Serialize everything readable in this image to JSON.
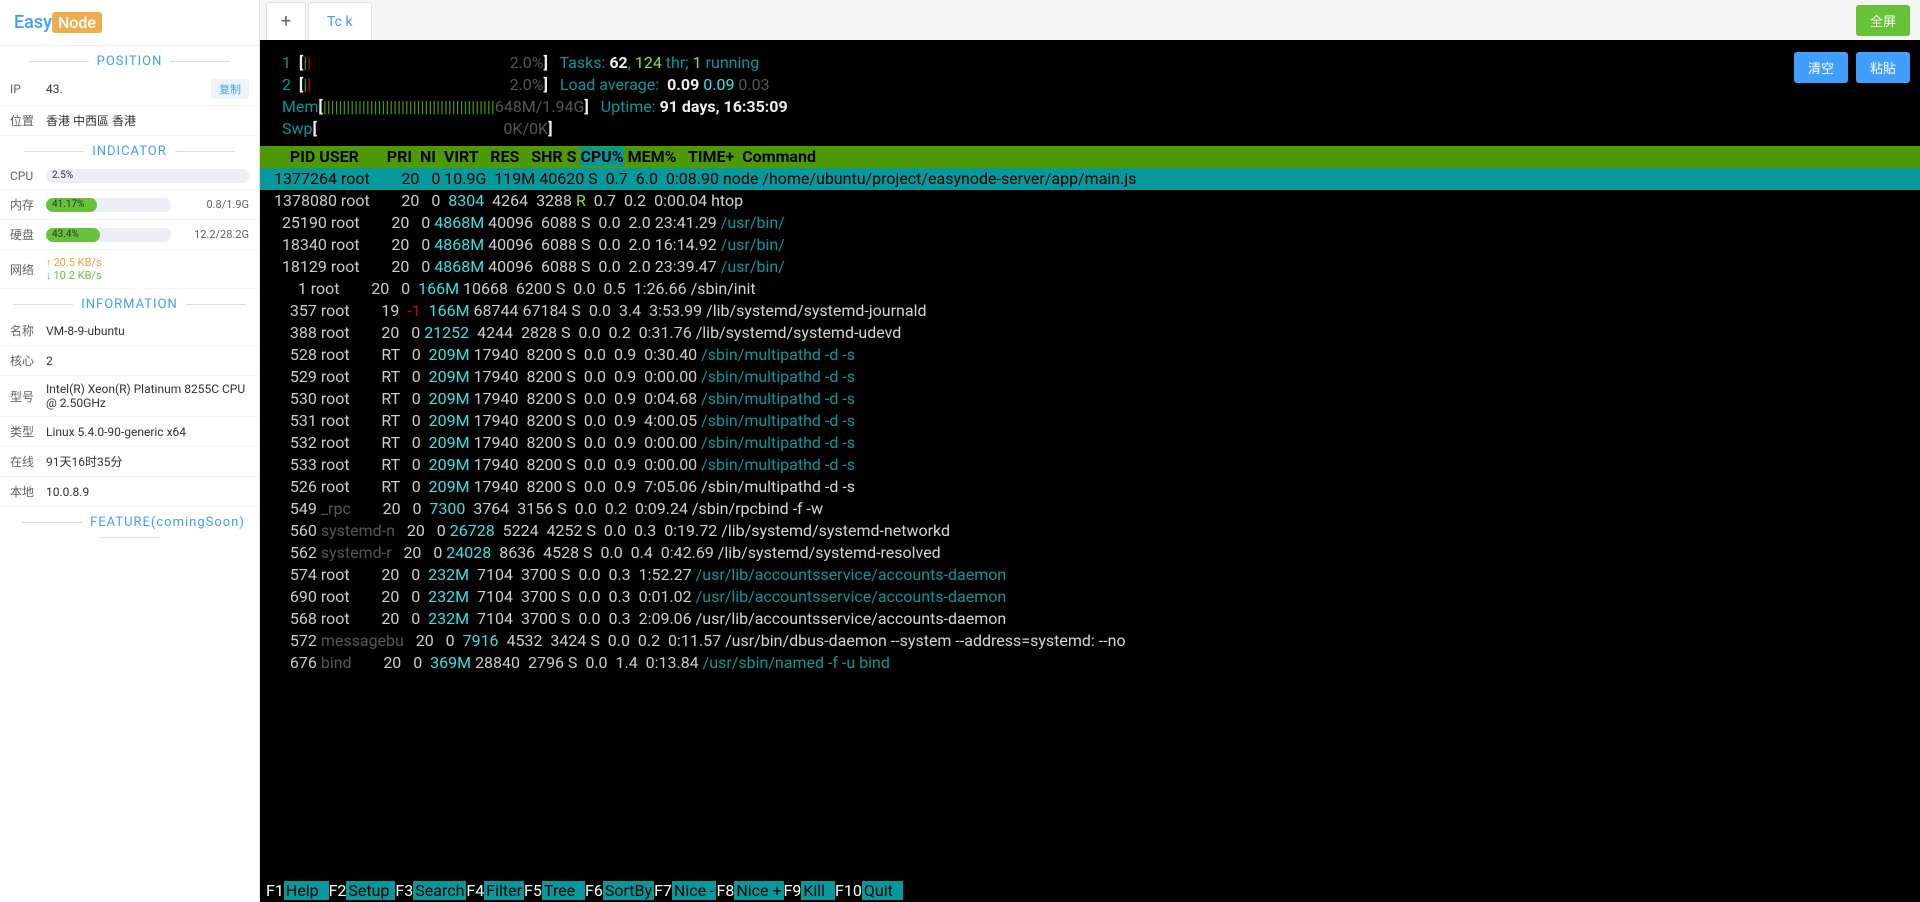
{
  "logo": {
    "part1": "Easy",
    "part2": "Node"
  },
  "tabs": {
    "add": "+",
    "active": "Tc       k"
  },
  "buttons": {
    "fullscreen": "全屏",
    "clear": "清空",
    "paste": "粘貼",
    "copy": "复制"
  },
  "sections": {
    "position": "POSITION",
    "indicator": "INDICATOR",
    "information": "INFORMATION",
    "feature": "FEATURE(comingSoon)"
  },
  "position": {
    "ip_label": "IP",
    "ip_value": "43.",
    "loc_label": "位置",
    "loc_value": "香港 中西區 香港"
  },
  "indicator": {
    "cpu_label": "CPU",
    "cpu_pct": "2.5%",
    "cpu_width": "2.5%",
    "mem_label": "内存",
    "mem_pct": "41.17%",
    "mem_width": "41.17%",
    "mem_right": "0.8/1.9G",
    "disk_label": "硬盘",
    "disk_pct": "43.4%",
    "disk_width": "43.4%",
    "disk_right": "12.2/28.2G",
    "net_label": "网络",
    "net_up": "20.5 KB/s",
    "net_down": "10.2 KB/s"
  },
  "info": {
    "name_label": "名称",
    "name_value": "VM-8-9-ubuntu",
    "cores_label": "核心",
    "cores_value": "2",
    "model_label": "型号",
    "model_value": "Intel(R) Xeon(R) Platinum 8255C CPU @ 2.50GHz",
    "type_label": "类型",
    "type_value": "Linux 5.4.0-90-generic x64",
    "online_label": "在线",
    "online_value": "91天16时35分",
    "local_label": "本地",
    "local_value": "10.0.8.9"
  },
  "htop": {
    "cpu1_pct": "2.0%",
    "cpu2_pct": "2.0%",
    "mem_used": "648M",
    "mem_total": "1.94G",
    "swp": "0K/0K",
    "tasks_label": "Tasks: ",
    "tasks": "62",
    "threads": "124",
    "thr_txt": " thr; ",
    "running": "1",
    "running_txt": " running",
    "load_label": "Load average:  ",
    "load1": "0.09",
    "load2": "0.09",
    "load3": "0.03",
    "uptime_label": "Uptime: ",
    "uptime": "91 days, 16:35:09",
    "header": "    PID USER       PRI  NI  VIRT   RES   SHR S CPU% MEM%   TIME+  Command",
    "rows": [
      {
        "sel": true,
        "pid": "1377264",
        "user": "root",
        "pri": "20",
        "ni": "0",
        "virt": "10.9G",
        "res": "119M",
        "shr": "40620",
        "s": "S",
        "cpu": "0.7",
        "mem": "6.0",
        "time": "0:08.90",
        "cmd": "node /home/ubuntu/project/easynode-server/app/main.js",
        "dimcmd": false
      },
      {
        "pid": "1378080",
        "user": "root",
        "pri": "20",
        "ni": "0",
        "virt": "8304",
        "res": "4264",
        "shr": "3288",
        "s": "R",
        "cpu": "0.7",
        "mem": "0.2",
        "time": "0:00.04",
        "cmd": "htop"
      },
      {
        "pid": "25190",
        "user": "root",
        "pri": "20",
        "ni": "0",
        "virt": "4868M",
        "res": "40096",
        "shr": "6088",
        "s": "S",
        "cpu": "0.0",
        "mem": "2.0",
        "time": "23:41.29",
        "cmd": "/usr/bin/",
        "dimcmd": true
      },
      {
        "pid": "18340",
        "user": "root",
        "pri": "20",
        "ni": "0",
        "virt": "4868M",
        "res": "40096",
        "shr": "6088",
        "s": "S",
        "cpu": "0.0",
        "mem": "2.0",
        "time": "16:14.92",
        "cmd": "/usr/bin/",
        "dimcmd": true
      },
      {
        "pid": "18129",
        "user": "root",
        "pri": "20",
        "ni": "0",
        "virt": "4868M",
        "res": "40096",
        "shr": "6088",
        "s": "S",
        "cpu": "0.0",
        "mem": "2.0",
        "time": "23:39.47",
        "cmd": "/usr/bin/",
        "dimcmd": true
      },
      {
        "pid": "1",
        "user": "root",
        "pri": "20",
        "ni": "0",
        "virt": "166M",
        "res": "10668",
        "shr": "6200",
        "s": "S",
        "cpu": "0.0",
        "mem": "0.5",
        "time": "1:26.66",
        "cmd": "/sbin/init"
      },
      {
        "pid": "357",
        "user": "root",
        "pri": "19",
        "ni": "-1",
        "virt": "166M",
        "res": "68744",
        "shr": "67184",
        "s": "S",
        "cpu": "0.0",
        "mem": "3.4",
        "time": "3:53.99",
        "cmd": "/lib/systemd/systemd-journald"
      },
      {
        "pid": "388",
        "user": "root",
        "pri": "20",
        "ni": "0",
        "virt": "21252",
        "res": "4244",
        "shr": "2828",
        "s": "S",
        "cpu": "0.0",
        "mem": "0.2",
        "time": "0:31.76",
        "cmd": "/lib/systemd/systemd-udevd"
      },
      {
        "pid": "528",
        "user": "root",
        "pri": "RT",
        "ni": "0",
        "virt": "209M",
        "res": "17940",
        "shr": "8200",
        "s": "S",
        "cpu": "0.0",
        "mem": "0.9",
        "time": "0:30.40",
        "cmd": "/sbin/multipathd -d -s",
        "dimcmd": true
      },
      {
        "pid": "529",
        "user": "root",
        "pri": "RT",
        "ni": "0",
        "virt": "209M",
        "res": "17940",
        "shr": "8200",
        "s": "S",
        "cpu": "0.0",
        "mem": "0.9",
        "time": "0:00.00",
        "cmd": "/sbin/multipathd -d -s",
        "dimcmd": true
      },
      {
        "pid": "530",
        "user": "root",
        "pri": "RT",
        "ni": "0",
        "virt": "209M",
        "res": "17940",
        "shr": "8200",
        "s": "S",
        "cpu": "0.0",
        "mem": "0.9",
        "time": "0:04.68",
        "cmd": "/sbin/multipathd -d -s",
        "dimcmd": true
      },
      {
        "pid": "531",
        "user": "root",
        "pri": "RT",
        "ni": "0",
        "virt": "209M",
        "res": "17940",
        "shr": "8200",
        "s": "S",
        "cpu": "0.0",
        "mem": "0.9",
        "time": "4:00.05",
        "cmd": "/sbin/multipathd -d -s",
        "dimcmd": true
      },
      {
        "pid": "532",
        "user": "root",
        "pri": "RT",
        "ni": "0",
        "virt": "209M",
        "res": "17940",
        "shr": "8200",
        "s": "S",
        "cpu": "0.0",
        "mem": "0.9",
        "time": "0:00.00",
        "cmd": "/sbin/multipathd -d -s",
        "dimcmd": true
      },
      {
        "pid": "533",
        "user": "root",
        "pri": "RT",
        "ni": "0",
        "virt": "209M",
        "res": "17940",
        "shr": "8200",
        "s": "S",
        "cpu": "0.0",
        "mem": "0.9",
        "time": "0:00.00",
        "cmd": "/sbin/multipathd -d -s",
        "dimcmd": true
      },
      {
        "pid": "526",
        "user": "root",
        "pri": "RT",
        "ni": "0",
        "virt": "209M",
        "res": "17940",
        "shr": "8200",
        "s": "S",
        "cpu": "0.0",
        "mem": "0.9",
        "time": "7:05.06",
        "cmd": "/sbin/multipathd -d -s"
      },
      {
        "pid": "549",
        "user": "_rpc",
        "pri": "20",
        "ni": "0",
        "virt": "7300",
        "res": "3764",
        "shr": "3156",
        "s": "S",
        "cpu": "0.0",
        "mem": "0.2",
        "time": "0:09.24",
        "cmd": "/sbin/rpcbind -f -w"
      },
      {
        "pid": "560",
        "user": "systemd-n",
        "pri": "20",
        "ni": "0",
        "virt": "26728",
        "res": "5224",
        "shr": "4252",
        "s": "S",
        "cpu": "0.0",
        "mem": "0.3",
        "time": "0:19.72",
        "cmd": "/lib/systemd/systemd-networkd"
      },
      {
        "pid": "562",
        "user": "systemd-r",
        "pri": "20",
        "ni": "0",
        "virt": "24028",
        "res": "8636",
        "shr": "4528",
        "s": "S",
        "cpu": "0.0",
        "mem": "0.4",
        "time": "0:42.69",
        "cmd": "/lib/systemd/systemd-resolved"
      },
      {
        "pid": "574",
        "user": "root",
        "pri": "20",
        "ni": "0",
        "virt": "232M",
        "res": "7104",
        "shr": "3700",
        "s": "S",
        "cpu": "0.0",
        "mem": "0.3",
        "time": "1:52.27",
        "cmd": "/usr/lib/accountsservice/accounts-daemon",
        "dimcmd": true
      },
      {
        "pid": "690",
        "user": "root",
        "pri": "20",
        "ni": "0",
        "virt": "232M",
        "res": "7104",
        "shr": "3700",
        "s": "S",
        "cpu": "0.0",
        "mem": "0.3",
        "time": "0:01.02",
        "cmd": "/usr/lib/accountsservice/accounts-daemon",
        "dimcmd": true
      },
      {
        "pid": "568",
        "user": "root",
        "pri": "20",
        "ni": "0",
        "virt": "232M",
        "res": "7104",
        "shr": "3700",
        "s": "S",
        "cpu": "0.0",
        "mem": "0.3",
        "time": "2:09.06",
        "cmd": "/usr/lib/accountsservice/accounts-daemon"
      },
      {
        "pid": "572",
        "user": "messagebu",
        "pri": "20",
        "ni": "0",
        "virt": "7916",
        "res": "4532",
        "shr": "3424",
        "s": "S",
        "cpu": "0.0",
        "mem": "0.2",
        "time": "0:11.57",
        "cmd": "/usr/bin/dbus-daemon --system --address=systemd: --no"
      },
      {
        "pid": "676",
        "user": "bind",
        "pri": "20",
        "ni": "0",
        "virt": "369M",
        "res": "28840",
        "shr": "2796",
        "s": "S",
        "cpu": "0.0",
        "mem": "1.4",
        "time": "0:13.84",
        "cmd": "/usr/sbin/named -f -u bind",
        "dimcmd": true
      }
    ],
    "fns": [
      {
        "k": "F1",
        "l": "Help  "
      },
      {
        "k": "F2",
        "l": "Setup "
      },
      {
        "k": "F3",
        "l": "Search"
      },
      {
        "k": "F4",
        "l": "Filter"
      },
      {
        "k": "F5",
        "l": "Tree  "
      },
      {
        "k": "F6",
        "l": "SortBy"
      },
      {
        "k": "F7",
        "l": "Nice -"
      },
      {
        "k": "F8",
        "l": "Nice +"
      },
      {
        "k": "F9",
        "l": "Kill  "
      },
      {
        "k": "F10",
        "l": "Quit  "
      }
    ]
  }
}
